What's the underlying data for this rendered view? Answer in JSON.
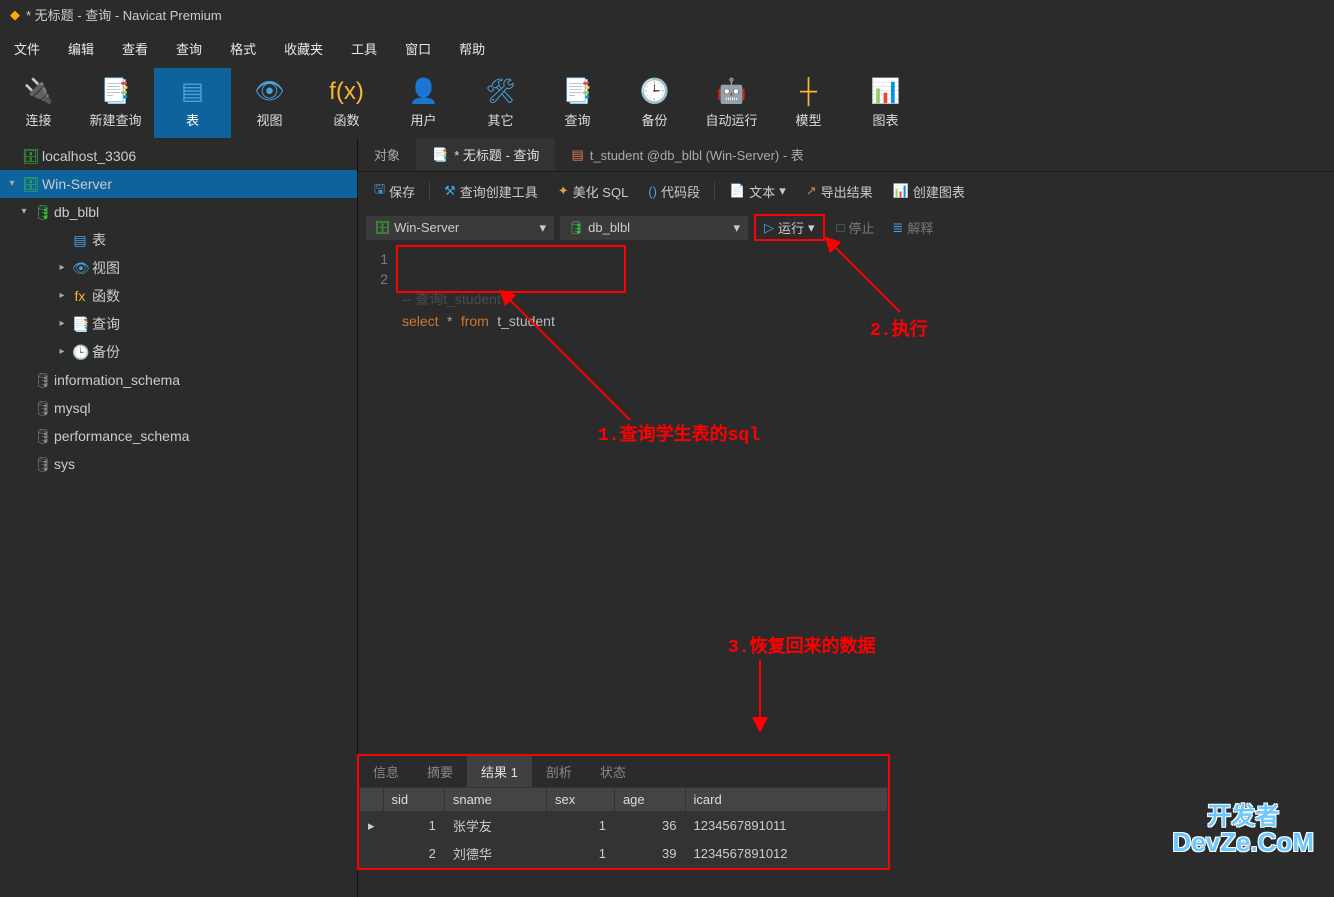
{
  "title": {
    "text": "* 无标题 - 查询 - Navicat Premium"
  },
  "menu": [
    "文件",
    "编辑",
    "查看",
    "查询",
    "格式",
    "收藏夹",
    "工具",
    "窗口",
    "帮助"
  ],
  "tools": [
    {
      "label": "连接",
      "icon": "🔌",
      "color": "#7bc47f"
    },
    {
      "label": "新建查询",
      "icon": "📑",
      "color": "#e07b53"
    },
    {
      "label": "表",
      "icon": "▤",
      "color": "#4aa3df",
      "active": true
    },
    {
      "label": "视图",
      "icon": "👁",
      "color": "#4aa3df"
    },
    {
      "label": "函数",
      "icon": "f(x)",
      "color": "#f7b731"
    },
    {
      "label": "用户",
      "icon": "👤",
      "color": "#e67e22"
    },
    {
      "label": "其它",
      "icon": "🛠",
      "color": "#4aa3df"
    },
    {
      "label": "查询",
      "icon": "📑",
      "color": "#e07b53"
    },
    {
      "label": "备份",
      "icon": "🕒",
      "color": "#4aa3df"
    },
    {
      "label": "自动运行",
      "icon": "🤖",
      "color": "#3bc"
    },
    {
      "label": "模型",
      "icon": "┼",
      "color": "#f7b731"
    },
    {
      "label": "图表",
      "icon": "📊",
      "color": "#c75c8a"
    }
  ],
  "tree": [
    {
      "label": "localhost_3306",
      "ind": 0,
      "arrow": "",
      "icon": "🗄",
      "iconcolor": "#3cc13b"
    },
    {
      "label": "Win-Server",
      "ind": 0,
      "arrow": "▾",
      "icon": "🗄",
      "iconcolor": "#3cc13b",
      "sel": true
    },
    {
      "label": "db_blbl",
      "ind": 1,
      "arrow": "▾",
      "icon": "🛢",
      "iconcolor": "#3cc13b"
    },
    {
      "label": "表",
      "ind": 3,
      "arrow": "",
      "icon": "▤",
      "iconcolor": "#4aa3df"
    },
    {
      "label": "视图",
      "ind": 3,
      "arrow": "▸",
      "icon": "👁",
      "iconcolor": "#4aa3df"
    },
    {
      "label": "函数",
      "ind": 3,
      "arrow": "▸",
      "icon": "fx",
      "iconcolor": "#f7b731"
    },
    {
      "label": "查询",
      "ind": 3,
      "arrow": "▸",
      "icon": "📑",
      "iconcolor": "#e07b53"
    },
    {
      "label": "备份",
      "ind": 3,
      "arrow": "▸",
      "icon": "🕒",
      "iconcolor": "#4aa3df"
    },
    {
      "label": "information_schema",
      "ind": 1,
      "arrow": "",
      "icon": "🛢",
      "iconcolor": "#888"
    },
    {
      "label": "mysql",
      "ind": 1,
      "arrow": "",
      "icon": "🛢",
      "iconcolor": "#888"
    },
    {
      "label": "performance_schema",
      "ind": 1,
      "arrow": "",
      "icon": "🛢",
      "iconcolor": "#888"
    },
    {
      "label": "sys",
      "ind": 1,
      "arrow": "",
      "icon": "🛢",
      "iconcolor": "#888"
    }
  ],
  "tabs": [
    {
      "label": "对象",
      "icon": "",
      "active": false
    },
    {
      "label": "* 无标题 - 查询",
      "icon": "📑",
      "active": true
    },
    {
      "label": "t_student @db_blbl (Win-Server) - 表",
      "icon": "▤",
      "active": false
    }
  ],
  "subtool": {
    "save": "保存",
    "query_builder": "查询创建工具",
    "beautify": "美化 SQL",
    "snippet": "代码段",
    "text": "文本",
    "export": "导出结果",
    "chart": "创建图表"
  },
  "dbbar": {
    "server": "Win-Server",
    "db": "db_blbl",
    "run": "运行",
    "stop": "停止",
    "explain": "解释"
  },
  "code": {
    "l1": "1",
    "l2": "2",
    "comment": "-- 查询t_student",
    "select": "select",
    "star": "*",
    "from": "from",
    "tbl": "t_student"
  },
  "annot": {
    "a1": "1.查询学生表的sql",
    "a2": "2.执行",
    "a3": "3.恢复回来的数据"
  },
  "rtabs": [
    "信息",
    "摘要",
    "结果 1",
    "剖析",
    "状态"
  ],
  "rtab_active": "结果 1",
  "cols": [
    "sid",
    "sname",
    "sex",
    "age",
    "icard"
  ],
  "rows": [
    {
      "ind": "▸",
      "sid": "1",
      "sname": "张学友",
      "sex": "1",
      "age": "36",
      "icard": "1234567891011"
    },
    {
      "ind": "",
      "sid": "2",
      "sname": "刘德华",
      "sex": "1",
      "age": "39",
      "icard": "1234567891012"
    }
  ],
  "wm": {
    "t1": "开发者",
    "t2": "DevZe.CoM"
  }
}
